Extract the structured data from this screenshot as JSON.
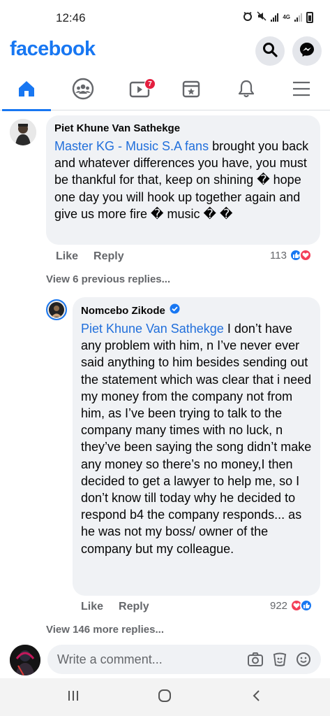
{
  "status_bar": {
    "time": "12:46",
    "network": "4G"
  },
  "header": {
    "logo": "facebook"
  },
  "tabs": [
    {
      "name": "home",
      "icon": "home-icon",
      "active": true
    },
    {
      "name": "groups",
      "icon": "groups-icon"
    },
    {
      "name": "watch",
      "icon": "watch-icon",
      "badge": "7"
    },
    {
      "name": "marketplace",
      "icon": "marketplace-icon"
    },
    {
      "name": "notifications",
      "icon": "bell-icon"
    },
    {
      "name": "menu",
      "icon": "menu-icon"
    }
  ],
  "comment1": {
    "author": "Piet Khune Van Sathekge",
    "mention": "Master KG - Music S.A fans",
    "text": " brought you back and whatever differences you have, you must be thankful for that, keep on shining � hope one day you will hook up together again and give us more fire � music � �",
    "like_label": "Like",
    "reply_label": "Reply",
    "reaction_count": "113",
    "view_replies": "View 6 previous replies..."
  },
  "comment2": {
    "author": "Nomcebo Zikode",
    "mention": "Piet Khune Van Sathekge",
    "text": " I don’t have any problem with him, n I’ve never ever said anything to him besides sending out the statement which was clear that i need my money from the company not from him, as I’ve been trying to talk to the company many times with no luck, n they’ve been saying the song didn’t make any money so there’s no money,I then decided to get a lawyer to help me, so I don’t know till today why he decided to respond b4 the company responds... as he was not my boss/ owner of the company but my colleague.",
    "like_label": "Like",
    "reply_label": "Reply",
    "reaction_count": "922",
    "view_replies": "View 146 more replies..."
  },
  "composer": {
    "placeholder": "Write a comment..."
  },
  "colors": {
    "brand": "#1877f2",
    "bubble": "#f0f2f5",
    "mention": "#216fdb",
    "secondary_text": "#65676b",
    "badge": "#e41e3f",
    "love": "#f33e58"
  }
}
